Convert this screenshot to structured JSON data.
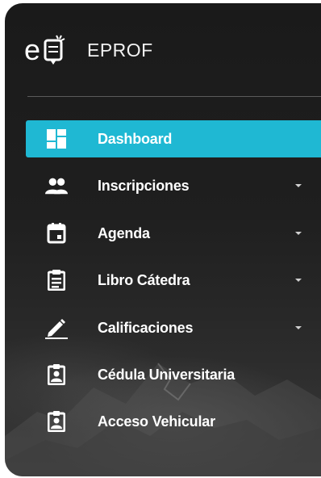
{
  "brand": {
    "title": "EPROF",
    "logo_icon": "eprof-logo-icon"
  },
  "colors": {
    "accent": "#1fb8d3",
    "sidebar_bg": "#1c1c1c",
    "text": "#ffffff"
  },
  "menu": [
    {
      "label": "Dashboard",
      "icon": "dashboard-icon",
      "active": true,
      "has_submenu": false
    },
    {
      "label": "Inscripciones",
      "icon": "people-icon",
      "active": false,
      "has_submenu": true
    },
    {
      "label": "Agenda",
      "icon": "calendar-icon",
      "active": false,
      "has_submenu": true
    },
    {
      "label": "Libro Cátedra",
      "icon": "clipboard-icon",
      "active": false,
      "has_submenu": true
    },
    {
      "label": "Calificaciones",
      "icon": "pencil-icon",
      "active": false,
      "has_submenu": true
    },
    {
      "label": "Cédula Universitaria",
      "icon": "id-badge-icon",
      "active": false,
      "has_submenu": false
    },
    {
      "label": "Acceso Vehicular",
      "icon": "id-badge-icon",
      "active": false,
      "has_submenu": false
    }
  ]
}
